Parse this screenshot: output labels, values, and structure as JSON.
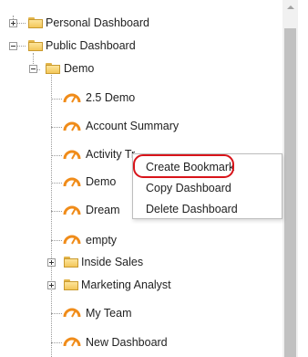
{
  "tree": {
    "personal_dashboard": "Personal Dashboard",
    "public_dashboard": "Public Dashboard",
    "demo_folder": "Demo",
    "items": {
      "demo_2_5": "2.5 Demo",
      "account_summary": "Account Summary",
      "activity_tracker": "Activity Tr",
      "demo_item": "Demo",
      "dream": "Dream",
      "empty": "empty",
      "inside_sales": "Inside Sales",
      "marketing_analyst": "Marketing Analyst",
      "my_team": "My Team",
      "new_dashboard": "New Dashboard"
    }
  },
  "context_menu": {
    "create_bookmark": "Create Bookmark",
    "copy_dashboard": "Copy Dashboard",
    "delete_dashboard": "Delete Dashboard"
  },
  "colors": {
    "gauge_orange": "#f08c1a",
    "folder_yellow": "#f3c75a",
    "highlight_red": "#d8141a"
  }
}
